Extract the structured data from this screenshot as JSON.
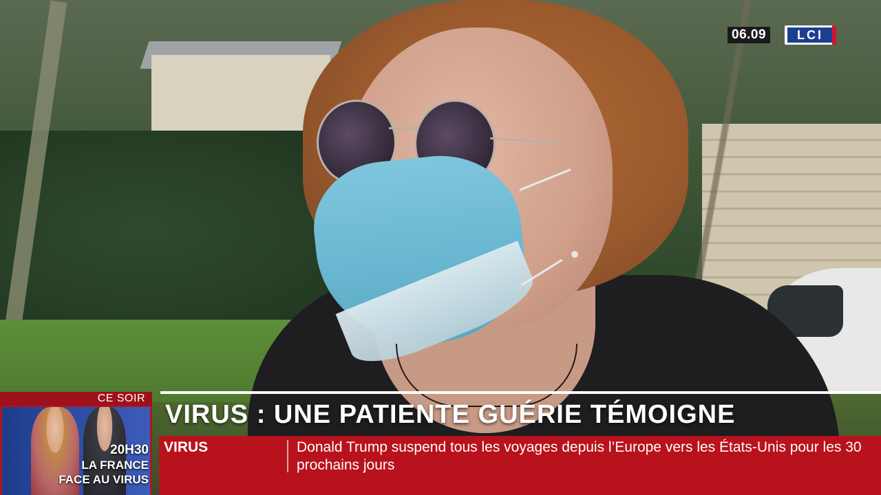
{
  "overlay": {
    "time": "06.09",
    "channel_logo": "LCI"
  },
  "teaser": {
    "kicker": "CE SOIR",
    "time": "20H30",
    "line1": "LA FRANCE",
    "line2": "FACE AU VIRUS"
  },
  "headline": {
    "text": "VIRUS : UNE PATIENTE GUÉRIE TÉMOIGNE"
  },
  "ticker": {
    "label": "VIRUS",
    "text": "Donald Trump suspend tous les voyages depuis l’Europe vers les États-Unis pour les 30 prochains jours"
  },
  "colors": {
    "ticker_red": "#b8121c",
    "logo_blue": "#1d3f8f"
  }
}
